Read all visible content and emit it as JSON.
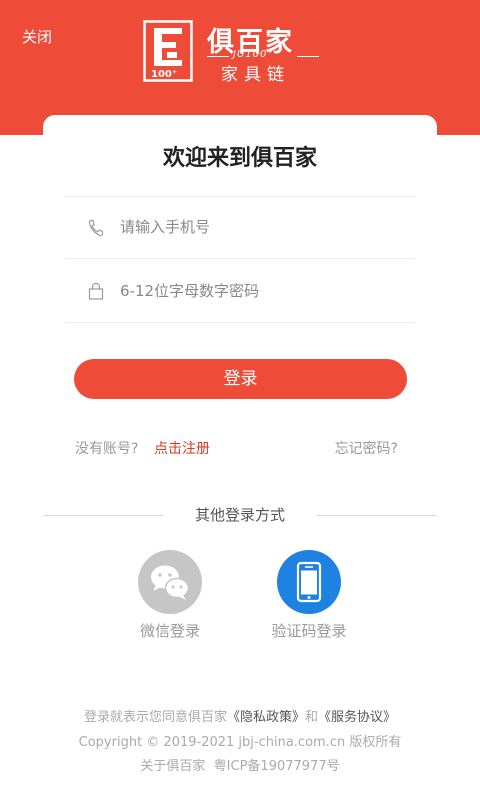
{
  "header": {
    "close_label": "关闭",
    "brand_name": "俱百家",
    "brand_sub": "JU100⁺",
    "brand_tag": "家具链",
    "brand_mark_text": "100⁺",
    "bg_color": "#ee4b38"
  },
  "login": {
    "welcome": "欢迎来到俱百家",
    "phone_placeholder": "请输入手机号",
    "password_placeholder": "6-12位字母数字密码",
    "phone_icon": "phone-icon",
    "lock_icon": "lock-icon",
    "submit_label": "登录",
    "no_account": "没有账号?",
    "register_label": "点击注册",
    "forgot_label": "忘记密码?"
  },
  "other": {
    "title": "其他登录方式",
    "wechat_label": "微信登录",
    "sms_label": "验证码登录",
    "wechat_icon": "wechat-icon",
    "mobile_icon": "mobile-icon"
  },
  "footer": {
    "agree_text": "登录就表示您同意俱百家",
    "privacy_link": "《隐私政策》",
    "and_text": "和",
    "service_link": "《服务协议》",
    "copyright": "Copyright © 2019-2021 jbj-china.com.cn 版权所有",
    "about": "关于俱百家",
    "icp": "粤ICP备19077977号"
  }
}
